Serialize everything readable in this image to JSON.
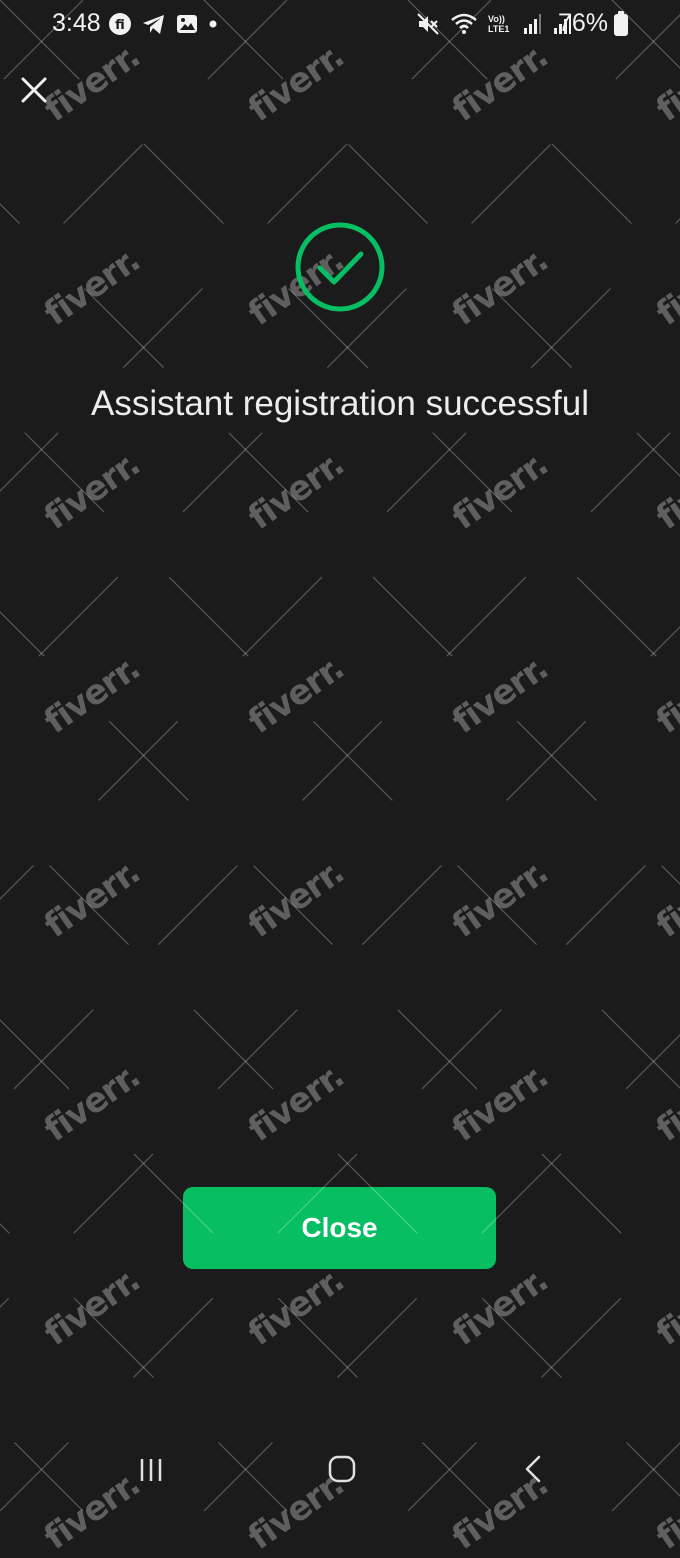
{
  "status_bar": {
    "time": "3:48",
    "left_icons": [
      "fi-app-icon",
      "telegram-icon",
      "gallery-icon",
      "dot-icon"
    ],
    "right_icons": [
      "mute-icon",
      "wifi-icon",
      "volte-icon",
      "signal-icon",
      "signal-icon"
    ],
    "volte_label": "Vo)) LTE1",
    "battery_percent": "76%"
  },
  "header": {
    "close_icon": "close-icon"
  },
  "main": {
    "status_icon": "check-circle-icon",
    "title": "Assistant registration successful"
  },
  "footer": {
    "close_label": "Close"
  },
  "nav_bar": {
    "icons": [
      "recents-icon",
      "home-icon",
      "back-icon"
    ]
  },
  "watermark": {
    "text": "fiverr."
  },
  "colors": {
    "background": "#1b1b1b",
    "accent": "#07be63",
    "text": "#ececec"
  }
}
